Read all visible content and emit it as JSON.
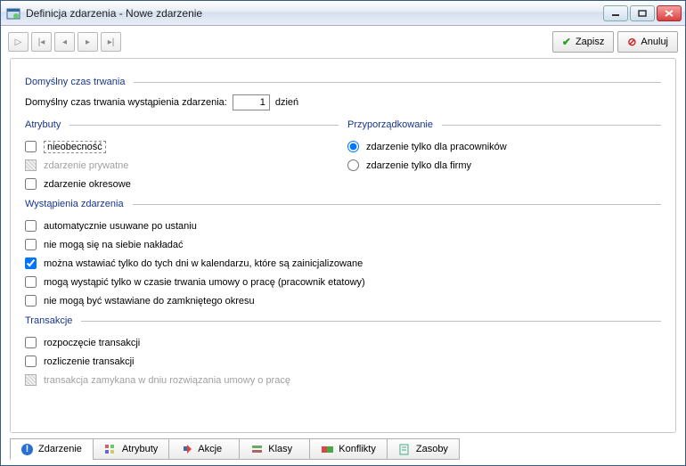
{
  "title": "Definicja zdarzenia - Nowe zdarzenie",
  "toolbar": {
    "save_label": "Zapisz",
    "cancel_label": "Anuluj"
  },
  "sections": {
    "duration_header": "Domyślny czas trwania",
    "duration_label": "Domyślny czas trwania wystąpienia zdarzenia:",
    "duration_value": "1",
    "duration_unit": "dzień",
    "attributes_header": "Atrybuty",
    "assignment_header": "Przyporządkowanie",
    "occurrences_header": "Wystąpienia zdarzenia",
    "transactions_header": "Transakcje"
  },
  "attributes": {
    "absence": "nieobecność",
    "private_event": "zdarzenie prywatne",
    "periodic_event": "zdarzenie okresowe"
  },
  "assignment": {
    "employees_only": "zdarzenie tylko dla pracowników",
    "company_only": "zdarzenie tylko dla firmy"
  },
  "occurrences": {
    "auto_removed": "automatycznie usuwane po ustaniu",
    "no_overlap": "nie mogą się na siebie nakładać",
    "only_initialized_days": "można wstawiać tylko do tych dni w kalendarzu, które są zainicjalizowane",
    "only_during_contract": "mogą wystąpić tylko w czasie trwania umowy o pracę (pracownik etatowy)",
    "not_closed_period": "nie mogą być wstawiane do zamkniętego okresu"
  },
  "transactions": {
    "start": "rozpoczęcie transakcji",
    "settlement": "rozliczenie transakcji",
    "closed_on_termination": "transakcja zamykana w dniu rozwiązania umowy o pracę"
  },
  "tabs": {
    "event": "Zdarzenie",
    "attributes": "Atrybuty",
    "actions": "Akcje",
    "classes": "Klasy",
    "conflicts": "Konflikty",
    "resources": "Zasoby"
  }
}
